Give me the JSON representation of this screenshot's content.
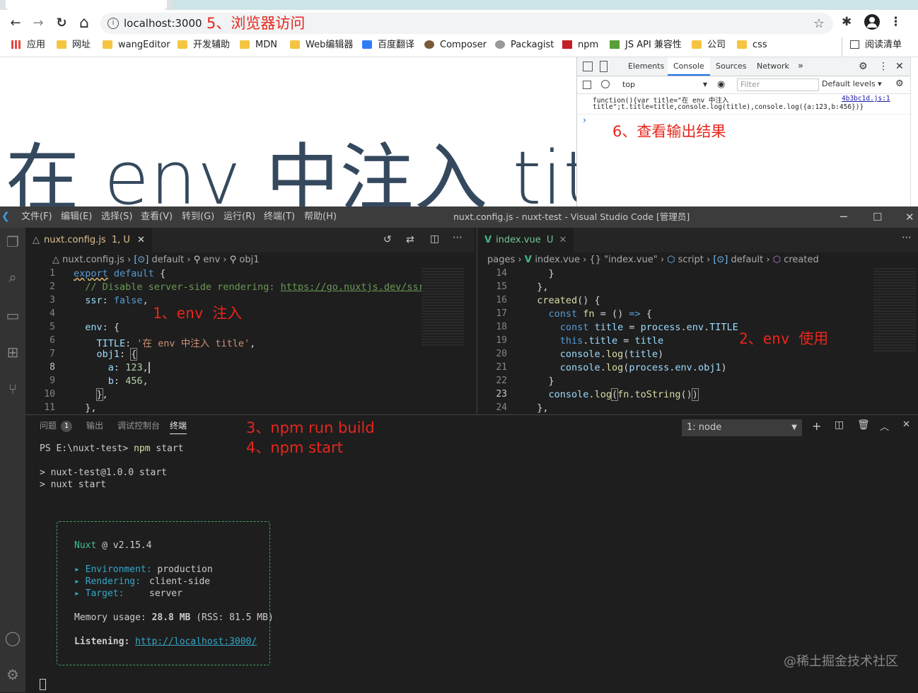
{
  "browser": {
    "url": "localhost:3000",
    "nav": {
      "back": "←",
      "forward": "→",
      "reload": "↻",
      "home": "⌂"
    },
    "bookmarks": [
      "应用",
      "网址",
      "wangEditor",
      "开发辅助",
      "MDN",
      "Web编辑器",
      "百度翻译",
      "Composer",
      "Packagist",
      "npm",
      "JS API 兼容性",
      "公司",
      "css"
    ],
    "reading_list": "阅读清单",
    "page_heading": "在 env 中注入 title",
    "devtools": {
      "tabs": [
        "Elements",
        "Console",
        "Sources",
        "Network",
        "»"
      ],
      "context": "top",
      "filter_placeholder": "Filter",
      "levels": "Default levels ▾",
      "log_line1": "function(){var title=\"在 env 中注入",
      "log_line2": "title\";t.title=title,console.log(title),console.log({a:123,b:456})}",
      "log_source": "4b3bc1d.js:1",
      "prompt": "›"
    }
  },
  "annotations": {
    "a5": "5、浏览器访问",
    "a6": "6、查看输出结果",
    "a1": "1、env 注入",
    "a2": "2、env 使用",
    "a3": "3、npm run build",
    "a4": "4、npm start",
    "watermark": "@稀土掘金技术社区"
  },
  "vscode": {
    "menus": [
      "文件(F)",
      "编辑(E)",
      "选择(S)",
      "查看(V)",
      "转到(G)",
      "运行(R)",
      "终端(T)",
      "帮助(H)"
    ],
    "title": "nuxt.config.js - nuxt-test - Visual Studio Code [管理员]",
    "editor1": {
      "tab": "nuxt.config.js",
      "tab_status": "1, U",
      "crumbs": [
        "nuxt.config.js",
        "default",
        "env",
        "obj1"
      ],
      "lines": [
        "1",
        "2",
        "3",
        "4",
        "5",
        "6",
        "7",
        "8",
        "9",
        "10",
        "11"
      ]
    },
    "editor2": {
      "tab": "index.vue",
      "tab_status": "U",
      "crumbs": [
        "pages",
        "index.vue",
        "{} \"index.vue\"",
        "script",
        "default",
        "created"
      ],
      "lines": [
        "14",
        "15",
        "16",
        "17",
        "18",
        "19",
        "20",
        "21",
        "22",
        "23",
        "24"
      ]
    },
    "panel": {
      "tabs": [
        "问题",
        "输出",
        "调试控制台",
        "终端"
      ],
      "problems_count": "1",
      "terminal_select": "1: node",
      "prompt": "PS E:\\nuxt-test>",
      "command": "npm",
      "command_arg": "start",
      "out1": "> nuxt-test@1.0.0 start",
      "out2": "> nuxt start",
      "nuxt_name": "Nuxt",
      "nuxt_version": "@ v2.15.4",
      "env_label": "Environment:",
      "env_value": "production",
      "render_label": "Rendering:",
      "render_value": "client-side",
      "target_label": "Target:",
      "target_value": "server",
      "memory": "Memory usage:",
      "memory_value": "28.8 MB",
      "rss": "(RSS: 81.5 MB)",
      "listening": "Listening:",
      "listen_url": "http://localhost:3000/"
    }
  }
}
